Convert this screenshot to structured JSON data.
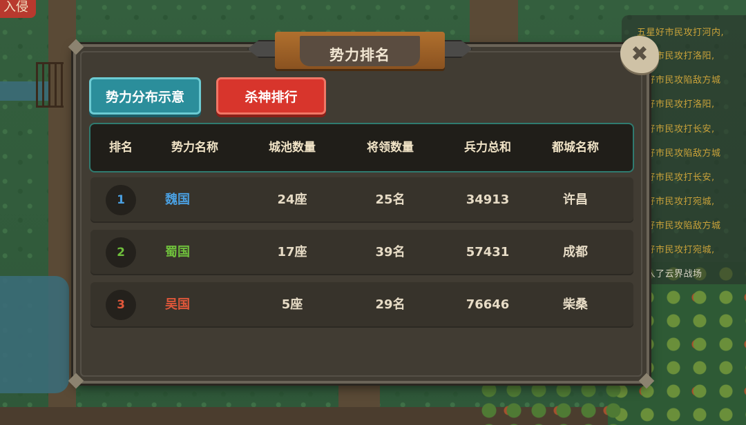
{
  "corner_button": {
    "label": "入侵"
  },
  "chat_log": [
    {
      "text": "五星好市民攻打河内,",
      "type": "event"
    },
    {
      "text": "瞳好市民攻打洛阳,",
      "type": "event"
    },
    {
      "text": "瞳好市民攻陷敌方城",
      "type": "event"
    },
    {
      "text": "瞳好市民攻打洛阳,",
      "type": "event"
    },
    {
      "text": "瞳好市民攻打长安,",
      "type": "event"
    },
    {
      "text": "瞳好市民攻陷敌方城",
      "type": "event"
    },
    {
      "text": "瞳好市民攻打长安,",
      "type": "event"
    },
    {
      "text": "瞳好市民攻打宛城,",
      "type": "event"
    },
    {
      "text": "瞳好市民攻陷敌方城",
      "type": "event"
    },
    {
      "text": "瞳好市民攻打宛城,",
      "type": "event"
    },
    {
      "text": "进入了云界战场",
      "type": "system"
    }
  ],
  "dialog": {
    "title": "势力排名",
    "close_icon": "close-icon",
    "buttons": {
      "distribution": "势力分布示意",
      "kill_rank": "杀神排行"
    },
    "columns": [
      "排名",
      "势力名称",
      "城池数量",
      "将领数量",
      "兵力总和",
      "都城名称"
    ],
    "rows": [
      {
        "rank": "1",
        "name": "魏国",
        "name_color": "#4a9fe0",
        "cities": "24座",
        "generals": "25名",
        "troops": "34913",
        "capital": "许昌"
      },
      {
        "rank": "2",
        "name": "蜀国",
        "name_color": "#6fbf3c",
        "cities": "17座",
        "generals": "39名",
        "troops": "57431",
        "capital": "成都"
      },
      {
        "rank": "3",
        "name": "吴国",
        "name_color": "#e0573a",
        "cities": "5座",
        "generals": "29名",
        "troops": "76646",
        "capital": "柴桑"
      }
    ]
  }
}
